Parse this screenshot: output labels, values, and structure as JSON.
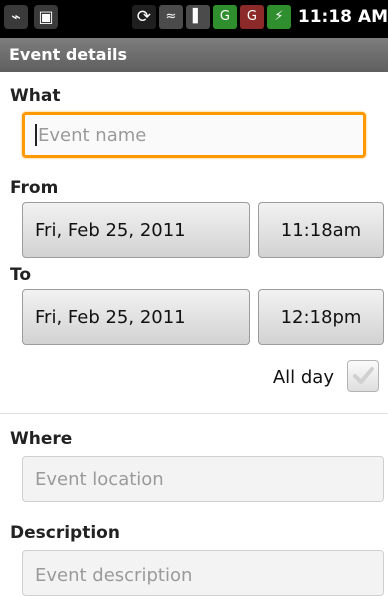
{
  "status_bar": {
    "time": "11:18 AM",
    "network_labels": [
      "G",
      "G"
    ]
  },
  "title_bar": {
    "title": "Event details"
  },
  "form": {
    "what": {
      "label": "What",
      "placeholder": "Event name"
    },
    "from": {
      "label": "From",
      "date": "Fri, Feb 25, 2011",
      "time": "11:18am"
    },
    "to": {
      "label": "To",
      "date": "Fri, Feb 25, 2011",
      "time": "12:18pm"
    },
    "all_day": {
      "label": "All day",
      "checked": false
    },
    "where": {
      "label": "Where",
      "placeholder": "Event location"
    },
    "description": {
      "label": "Description",
      "placeholder": "Event description"
    }
  },
  "colors": {
    "focus_border": "#ff9900",
    "title_bar": "#6f6f6f",
    "status_bar": "#000000"
  }
}
